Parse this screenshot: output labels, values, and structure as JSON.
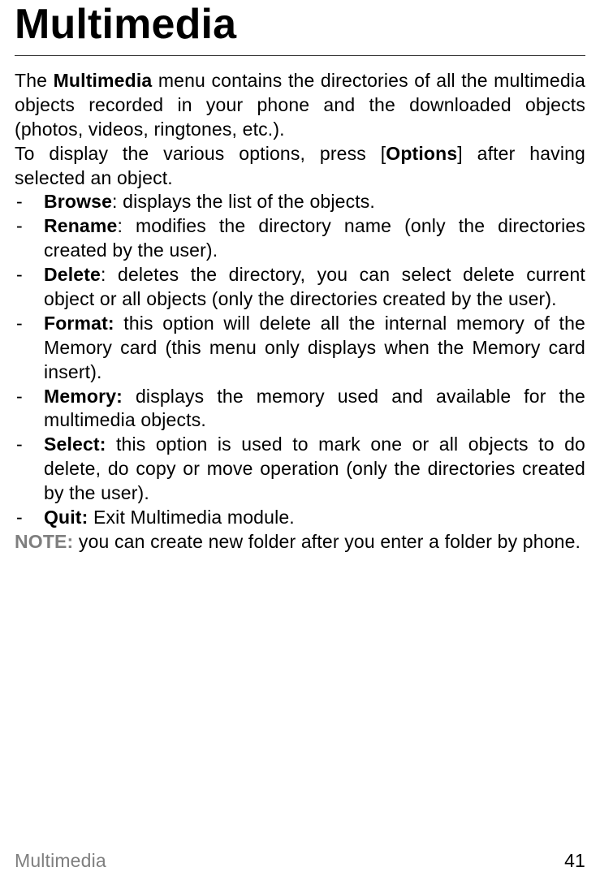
{
  "title": "Multimedia",
  "intro_parts": {
    "p1_a": "The ",
    "p1_b": "Multimedia",
    "p1_c": " menu contains the directories of all the multimedia objects recorded in your phone and the downloaded objects (photos, videos, ringtones, etc.).",
    "p2_a": "To display the various options, press [",
    "p2_b": "Options",
    "p2_c": "] after having selected an object."
  },
  "items": [
    {
      "term": "Browse",
      "sep": ": ",
      "desc": "displays the list of the objects."
    },
    {
      "term": "Rename",
      "sep": ": ",
      "desc": "modifies the directory name (only the directories created by the user)."
    },
    {
      "term": "Delete",
      "sep": ": ",
      "desc": "deletes the directory, you can select delete current object or all objects (only the directories created by the user)."
    },
    {
      "term": "Format:",
      "sep": " ",
      "desc": "this option will delete all the internal memory of the Memory card (this menu only displays when the Memory card insert)."
    },
    {
      "term": "Memory:",
      "sep": " ",
      "desc": "displays the memory used and available for the multimedia objects."
    },
    {
      "term": "Select:",
      "sep": " ",
      "desc": "this option is used to mark one or all objects to do delete, do copy or move operation (only the directories created by the user)."
    },
    {
      "term": "Quit:",
      "sep": " ",
      "desc": "Exit Multimedia module."
    }
  ],
  "note_label": "NOTE:",
  "note_text": " you can create new folder after you enter a folder by phone.",
  "dash": "-",
  "footer_section": "Multimedia",
  "footer_page": "41"
}
